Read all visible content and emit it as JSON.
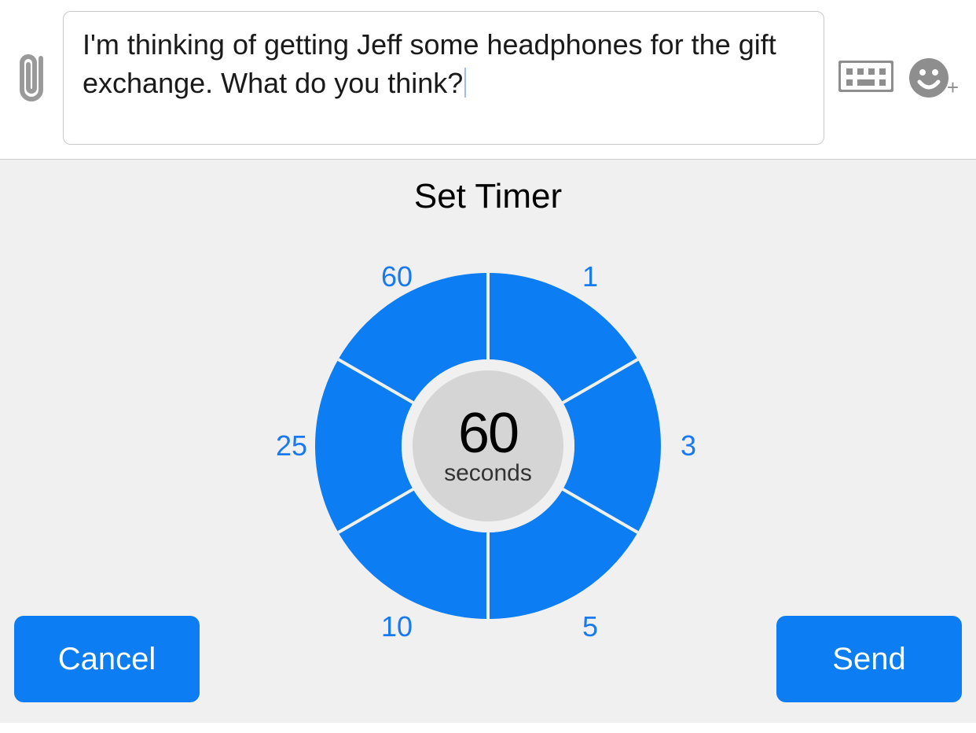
{
  "compose": {
    "message_text": "I'm thinking of getting Jeff some headphones for the gift exchange. What do you think?"
  },
  "timer_panel": {
    "title": "Set Timer",
    "value": "60",
    "unit": "seconds",
    "ticks": [
      "60",
      "1",
      "3",
      "5",
      "10",
      "25"
    ],
    "cancel_label": "Cancel",
    "send_label": "Send"
  },
  "colors": {
    "accent_blue": "#0c7df2",
    "tick_blue": "#1879f0",
    "panel_bg": "#f0f0f0",
    "dial_center": "#d5d5d5",
    "icon_gray": "#8e8e8e"
  },
  "icons": {
    "attach": "paperclip-icon",
    "keyboard": "keyboard-icon",
    "emoji": "emoji-add-icon"
  }
}
